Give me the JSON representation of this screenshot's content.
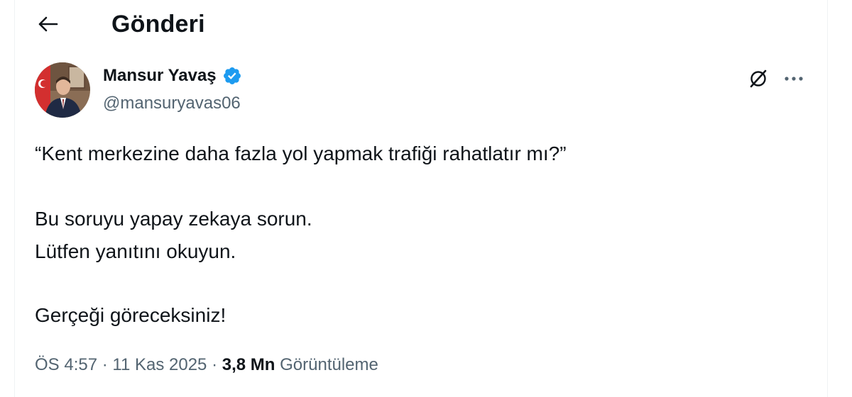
{
  "header": {
    "title": "Gönderi",
    "back_icon": "arrow-left-icon"
  },
  "author": {
    "name": "Mansur Yavaş",
    "handle": "@mansuryavas06",
    "verified_icon": "verified-badge-icon",
    "verified_color": "#1d9bf0"
  },
  "actions": {
    "grok_icon": "grok-icon",
    "more_icon": "more-horizontal-icon"
  },
  "tweet": {
    "lines": [
      "“Kent merkezine daha fazla yol yapmak trafiği rahatlatır mı?”",
      "Bu soruyu yapay zekaya sorun.",
      "Lütfen yanıtını okuyun.",
      "Gerçeği göreceksiniz!"
    ]
  },
  "meta": {
    "time": "ÖS 4:57",
    "separator": "·",
    "date": "11 Kas 2025",
    "views_count": "3,8 Mn",
    "views_label": "Görüntüleme"
  },
  "colors": {
    "text_primary": "#0f1419",
    "text_secondary": "#536471",
    "accent": "#1d9bf0"
  }
}
